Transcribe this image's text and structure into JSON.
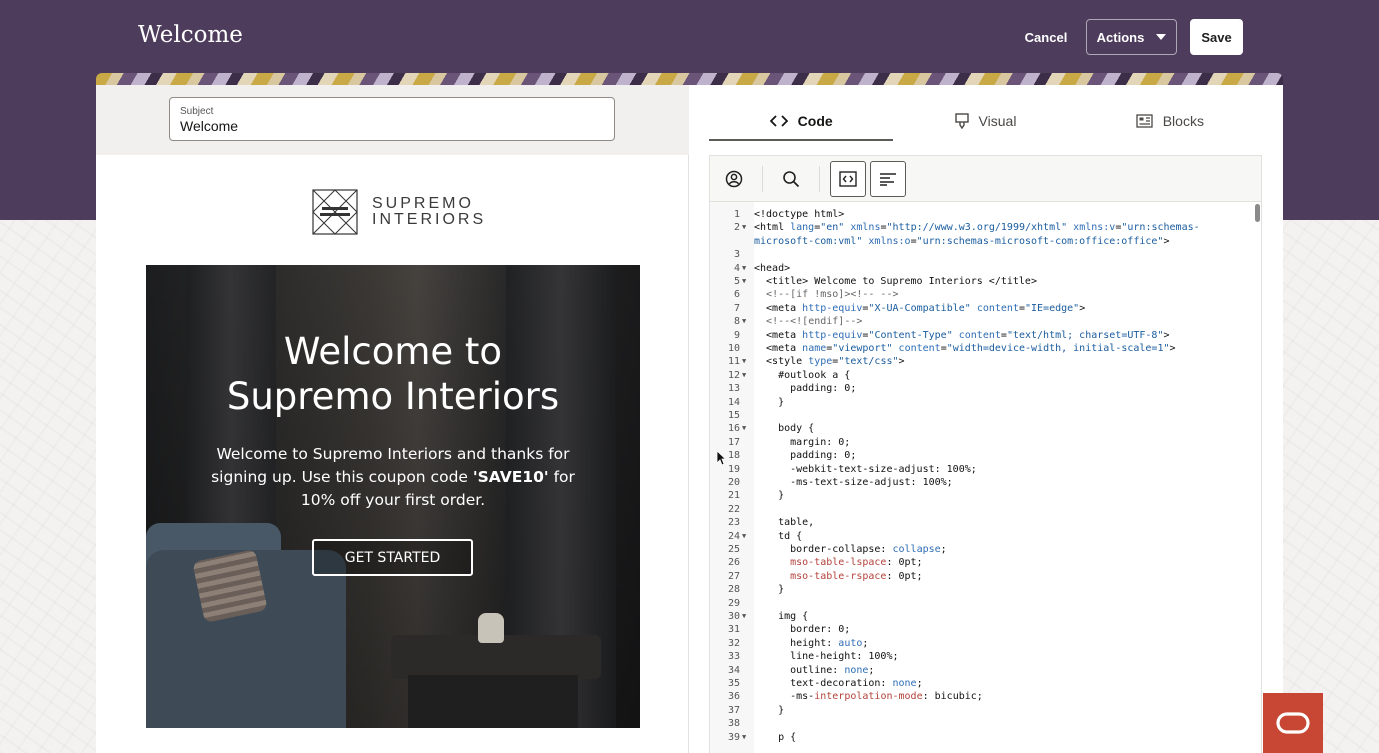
{
  "header": {
    "title": "Welcome",
    "cancel_label": "Cancel",
    "actions_label": "Actions",
    "save_label": "Save"
  },
  "subject": {
    "label": "Subject",
    "value": "Welcome"
  },
  "preview": {
    "logo_line1": "SUPREMO",
    "logo_line2": "INTERIORS",
    "hero_title_line1": "Welcome to",
    "hero_title_line2": "Supremo Interiors",
    "body_part1": "Welcome to Supremo Interiors and thanks for signing up. Use this coupon code ",
    "body_code": "'SAVE10'",
    "body_part2": " for 10% off your first order.",
    "cta_label": "GET STARTED"
  },
  "tabs": [
    {
      "label": "Code",
      "icon": "code-brackets-icon",
      "active": true
    },
    {
      "label": "Visual",
      "icon": "paint-brush-icon",
      "active": false
    },
    {
      "label": "Blocks",
      "icon": "blocks-icon",
      "active": false
    }
  ],
  "toolbar_icons": [
    "personalize-icon",
    "search-icon",
    "code-block-icon",
    "format-align-icon"
  ],
  "code_lines": [
    {
      "n": "1",
      "fold": false,
      "html": "<span style=\"color:#111\">&lt;!doctype html&gt;</span>"
    },
    {
      "n": "2",
      "fold": true,
      "html": "<span>&lt;html </span><span style=\"color:#2f6db5\">lang</span>=<span style=\"color:#1a5c9e\">\"en\"</span> <span style=\"color:#2f6db5\">xmlns</span>=<span style=\"color:#1a5c9e\">\"http://www.w3.org/1999/xhtml\"</span> <span style=\"color:#2f6db5\">xmlns:v</span>=<span style=\"color:#1a5c9e\">\"urn:schemas-</span>"
    },
    {
      "n": "",
      "fold": false,
      "html": "<span style=\"color:#1a5c9e\">microsoft-com:vml\"</span> <span style=\"color:#2f6db5\">xmlns:o</span>=<span style=\"color:#1a5c9e\">\"urn:schemas-microsoft-com:office:office\"</span>&gt;"
    },
    {
      "n": "3",
      "fold": false,
      "html": ""
    },
    {
      "n": "4",
      "fold": true,
      "html": "&lt;head&gt;"
    },
    {
      "n": "5",
      "fold": true,
      "html": "  &lt;title&gt; Welcome to Supremo Interiors &lt;/title&gt;"
    },
    {
      "n": "6",
      "fold": false,
      "html": "  <span style=\"color:#666\">&lt;!--[if !mso]&gt;&lt;!-- --&gt;</span>"
    },
    {
      "n": "7",
      "fold": false,
      "html": "  &lt;meta <span style=\"color:#2f6db5\">http-equiv</span>=<span style=\"color:#1a5c9e\">\"X-UA-Compatible\"</span> <span style=\"color:#2f6db5\">content</span>=<span style=\"color:#1a5c9e\">\"IE=edge\"</span>&gt;"
    },
    {
      "n": "8",
      "fold": true,
      "html": "  <span style=\"color:#666\">&lt;!--&lt;![endif]--&gt;</span>"
    },
    {
      "n": "9",
      "fold": false,
      "html": "  &lt;meta <span style=\"color:#2f6db5\">http-equiv</span>=<span style=\"color:#1a5c9e\">\"Content-Type\"</span> <span style=\"color:#2f6db5\">content</span>=<span style=\"color:#1a5c9e\">\"text/html; charset=UTF-8\"</span>&gt;"
    },
    {
      "n": "10",
      "fold": false,
      "html": "  &lt;meta <span style=\"color:#2f6db5\">name</span>=<span style=\"color:#1a5c9e\">\"viewport\"</span> <span style=\"color:#2f6db5\">content</span>=<span style=\"color:#1a5c9e\">\"width=device-width, initial-scale=1\"</span>&gt;"
    },
    {
      "n": "11",
      "fold": true,
      "html": "  &lt;style <span style=\"color:#2f6db5\">type</span>=<span style=\"color:#1a5c9e\">\"text/css\"</span>&gt;"
    },
    {
      "n": "12",
      "fold": true,
      "html": "    #outlook a {"
    },
    {
      "n": "13",
      "fold": false,
      "html": "      padding: 0;"
    },
    {
      "n": "14",
      "fold": false,
      "html": "    }"
    },
    {
      "n": "15",
      "fold": false,
      "html": ""
    },
    {
      "n": "16",
      "fold": true,
      "html": "    body {"
    },
    {
      "n": "17",
      "fold": false,
      "html": "      margin: 0;"
    },
    {
      "n": "18",
      "fold": false,
      "html": "      padding: 0;"
    },
    {
      "n": "19",
      "fold": false,
      "html": "      -webkit-text-size-adjust: 100%;"
    },
    {
      "n": "20",
      "fold": false,
      "html": "      -ms-text-size-adjust: 100%;"
    },
    {
      "n": "21",
      "fold": false,
      "html": "    }"
    },
    {
      "n": "22",
      "fold": false,
      "html": ""
    },
    {
      "n": "23",
      "fold": false,
      "html": "    table,"
    },
    {
      "n": "24",
      "fold": true,
      "html": "    td {"
    },
    {
      "n": "25",
      "fold": false,
      "html": "      border-collapse: <span style=\"color:#2f6db5\">collapse</span>;"
    },
    {
      "n": "26",
      "fold": false,
      "html": "      <span style=\"color:#b3423b\">mso-table-lspace</span>: 0pt;"
    },
    {
      "n": "27",
      "fold": false,
      "html": "      <span style=\"color:#b3423b\">mso-table-rspace</span>: 0pt;"
    },
    {
      "n": "28",
      "fold": false,
      "html": "    }"
    },
    {
      "n": "29",
      "fold": false,
      "html": ""
    },
    {
      "n": "30",
      "fold": true,
      "html": "    img {"
    },
    {
      "n": "31",
      "fold": false,
      "html": "      border: 0;"
    },
    {
      "n": "32",
      "fold": false,
      "html": "      height: <span style=\"color:#2f6db5\">auto</span>;"
    },
    {
      "n": "33",
      "fold": false,
      "html": "      line-height: 100%;"
    },
    {
      "n": "34",
      "fold": false,
      "html": "      outline: <span style=\"color:#2f6db5\">none</span>;"
    },
    {
      "n": "35",
      "fold": false,
      "html": "      text-decoration: <span style=\"color:#2f6db5\">none</span>;"
    },
    {
      "n": "36",
      "fold": false,
      "html": "      -ms-<span style=\"color:#b3423b\">interpolation-mode</span>: bicubic;"
    },
    {
      "n": "37",
      "fold": false,
      "html": "    }"
    },
    {
      "n": "38",
      "fold": false,
      "html": ""
    },
    {
      "n": "39",
      "fold": true,
      "html": "    p {"
    }
  ],
  "colors": {
    "header_bg": "#4d3c5b",
    "oracle_red": "#c74634"
  }
}
